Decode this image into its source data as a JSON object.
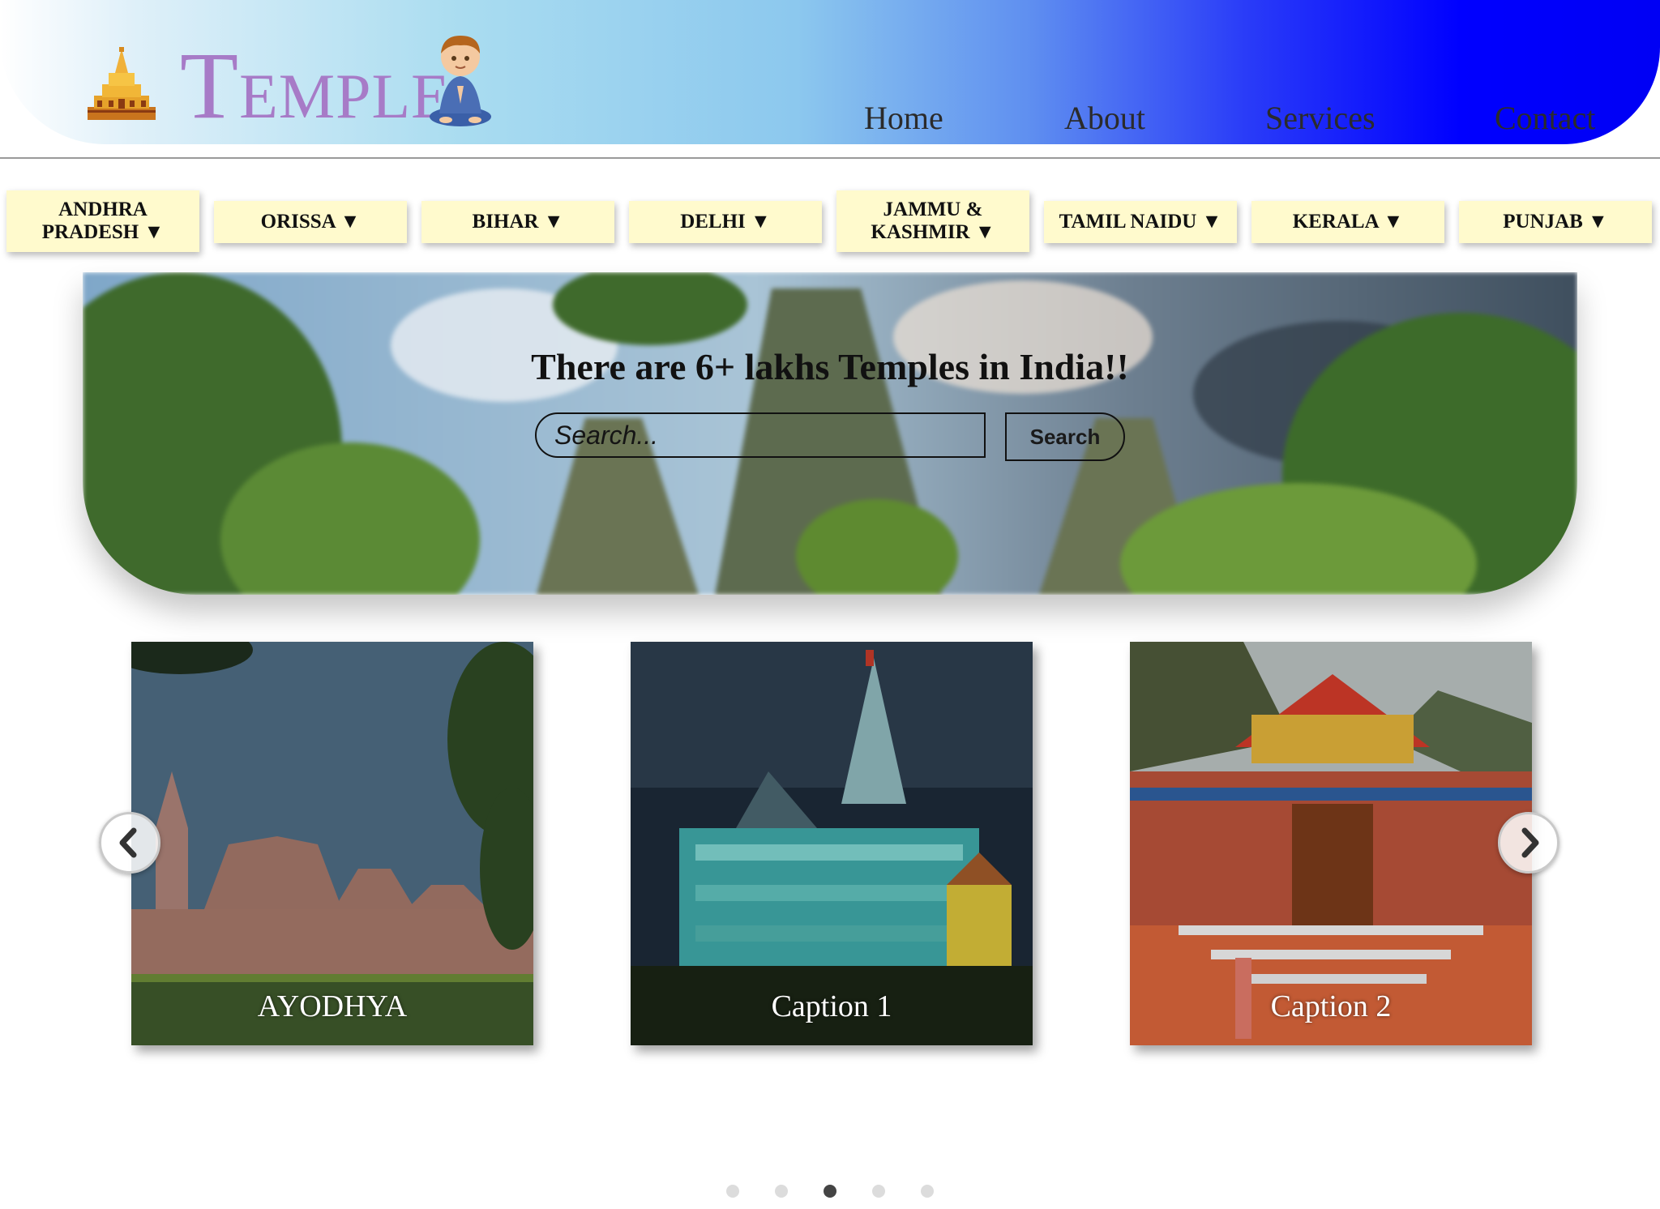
{
  "header": {
    "logo_first_letter": "T",
    "logo_rest": "EMPLE",
    "nav": [
      "Home",
      "About",
      "Services",
      "Contact"
    ]
  },
  "states": [
    {
      "line1": "ANDHRA",
      "line2": "PRADESH ▼"
    },
    {
      "label": "ORISSA ▼"
    },
    {
      "label": "BIHAR ▼"
    },
    {
      "label": "DELHI ▼"
    },
    {
      "line1": "JAMMU &",
      "line2": "KASHMIR ▼"
    },
    {
      "label": "TAMIL NAIDU ▼"
    },
    {
      "label": "KERALA ▼"
    },
    {
      "label": "PUNJAB ▼"
    }
  ],
  "hero": {
    "title": "There are 6+ lakhs Temples in India!!",
    "search_placeholder": "Search...",
    "search_button": "Search"
  },
  "carousel": {
    "captions": [
      "AYODHYA",
      "Caption 1",
      "Caption 2"
    ],
    "dot_count": 5,
    "active_dot_index": 2
  },
  "icons": {
    "logo_temple": "golden-temple-icon",
    "logo_monk": "meditating-monk-icon",
    "prev": "chevron-left-icon",
    "next": "chevron-right-icon"
  },
  "colors": {
    "header_gradient_start": "#ffffff",
    "header_gradient_end": "#0000ff",
    "logo_text": "#a77bc7",
    "tab_background": "#fffacd",
    "active_dot": "#444444",
    "inactive_dot": "#dcdcdc"
  }
}
